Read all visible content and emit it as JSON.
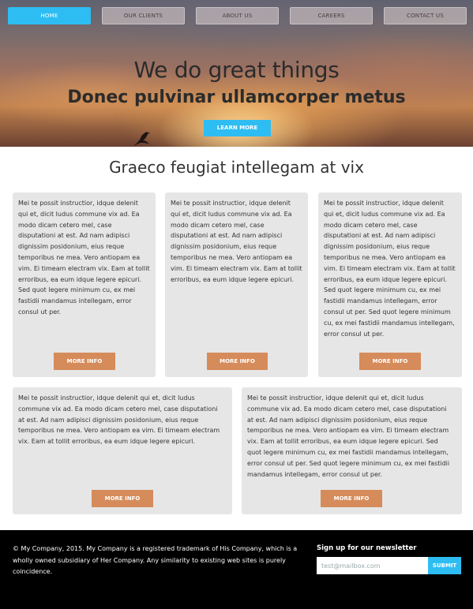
{
  "nav": {
    "items": [
      {
        "label": "HOME",
        "active": true
      },
      {
        "label": "OUR CLIENTS",
        "active": false
      },
      {
        "label": "ABOUT US",
        "active": false
      },
      {
        "label": "CAREERS",
        "active": false
      },
      {
        "label": "CONTACT US",
        "active": false
      }
    ]
  },
  "hero": {
    "title": "We do great things",
    "subtitle": "Donec pulvinar ullamcorper metus",
    "cta_label": "LEARN MORE"
  },
  "section": {
    "title": "Graeco feugiat intellegam at vix",
    "cards": [
      {
        "lines": [
          "Mei te possit instructior, idque delenit",
          "qui et, dicit ludus commune vix ad. Ea",
          "modo dicam cetero mel, case",
          "disputationi at est. Ad nam adipisci",
          "dignissim posidonium, eius reque",
          "temporibus ne mea. Vero antiopam ea",
          "vim. Ei timeam electram vix. Eam at tollit",
          "erroribus, ea eum idque legere epicuri.",
          "Sed quot legere minimum cu, ex mei",
          "fastidii mandamus intellegam, error",
          "consul ut per."
        ],
        "button_label": "MORE INFO"
      },
      {
        "lines": [
          "Mei te possit instructior, idque delenit",
          "qui et, dicit ludus commune vix ad. Ea",
          "modo dicam cetero mel, case",
          "disputationi at est. Ad nam adipisci",
          "dignissim posidonium, eius reque",
          "temporibus ne mea. Vero antiopam ea",
          "vim. Ei timeam electram vix. Eam at tollit",
          "erroribus, ea eum idque legere epicuri."
        ],
        "button_label": "MORE INFO"
      },
      {
        "lines": [
          "Mei te possit instructior, idque delenit",
          "qui et, dicit ludus commune vix ad. Ea",
          "modo dicam cetero mel, case",
          "disputationi at est. Ad nam adipisci",
          "dignissim posidonium, eius reque",
          "temporibus ne mea. Vero antiopam ea",
          "vim. Ei timeam electram vix. Eam at tollit",
          "erroribus, ea eum idque legere epicuri.",
          "Sed quot legere minimum cu, ex mei",
          "fastidii mandamus intellegam, error",
          "consul ut per. Sed quot legere minimum",
          "cu, ex mei fastidii mandamus intellegam,",
          "error consul ut per."
        ],
        "button_label": "MORE INFO"
      },
      {
        "lines": [
          "Mei te possit instructior, idque delenit qui et, dicit ludus",
          "commune vix ad. Ea modo dicam cetero mel, case disputationi",
          "at est. Ad nam adipisci dignissim posidonium, eius reque",
          "temporibus ne mea. Vero antiopam ea vim. Ei timeam electram",
          "vix. Eam at tollit erroribus, ea eum idque legere epicuri."
        ],
        "button_label": "MORE INFO"
      },
      {
        "lines": [
          "Mei te possit instructior, idque delenit qui et, dicit ludus",
          "commune vix ad. Ea modo dicam cetero mel, case disputationi",
          "at est. Ad nam adipisci dignissim posidonium, eius reque",
          "temporibus ne mea. Vero antiopam ea vim. Ei timeam electram",
          "vix. Eam at tollit erroribus, ea eum idque legere epicuri. Sed",
          "quot legere minimum cu, ex mei fastidii mandamus intellegam,",
          "error consul ut per. Sed quot legere minimum cu, ex mei fastidii",
          "mandamus intellegam, error consul ut per."
        ],
        "button_label": "MORE INFO"
      }
    ]
  },
  "footer": {
    "copyright_lines": [
      "© My Company, 2015. My Company is a registered trademark of His Company, which is a",
      "wholly owned subsidiary of Her Company. Any similarity to existing web sites is purely",
      "coincidence."
    ],
    "newsletter_heading": "Sign up for our newsletter",
    "newsletter_placeholder": "test@mailbox.com",
    "submit_label": "SUBMIT"
  },
  "colors": {
    "accent": "#2dbdf2",
    "more_button": "#d68b5a",
    "card_background": "#e6e6e6",
    "footer_background": "#000000"
  },
  "icons": {
    "hero_bird": "bird-icon"
  }
}
